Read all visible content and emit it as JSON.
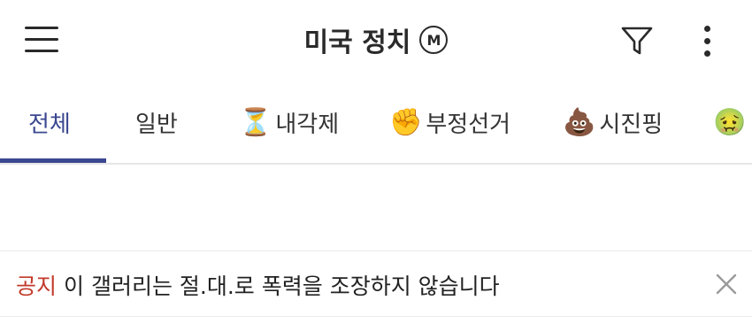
{
  "header": {
    "title": "미국 정치",
    "badge": "M",
    "icons": [
      "menu-icon",
      "filter-icon",
      "more-vertical-icon"
    ]
  },
  "tabs": [
    {
      "label": "전체",
      "emoji": "",
      "active": true
    },
    {
      "label": "일반",
      "emoji": "",
      "active": false
    },
    {
      "label": "내각제",
      "emoji": "⏳",
      "active": false
    },
    {
      "label": "부정선거",
      "emoji": "✊",
      "active": false
    },
    {
      "label": "시진핑",
      "emoji": "💩",
      "active": false
    },
    {
      "label": "",
      "emoji": "🤢",
      "active": false
    }
  ],
  "notice": {
    "tag": "공지",
    "text": "이 갤러리는 절.대.로 폭력을 조장하지 않습니다"
  },
  "colors": {
    "accent": "#3b4890",
    "notice_tag": "#c23a2a",
    "divider": "#ececec"
  }
}
